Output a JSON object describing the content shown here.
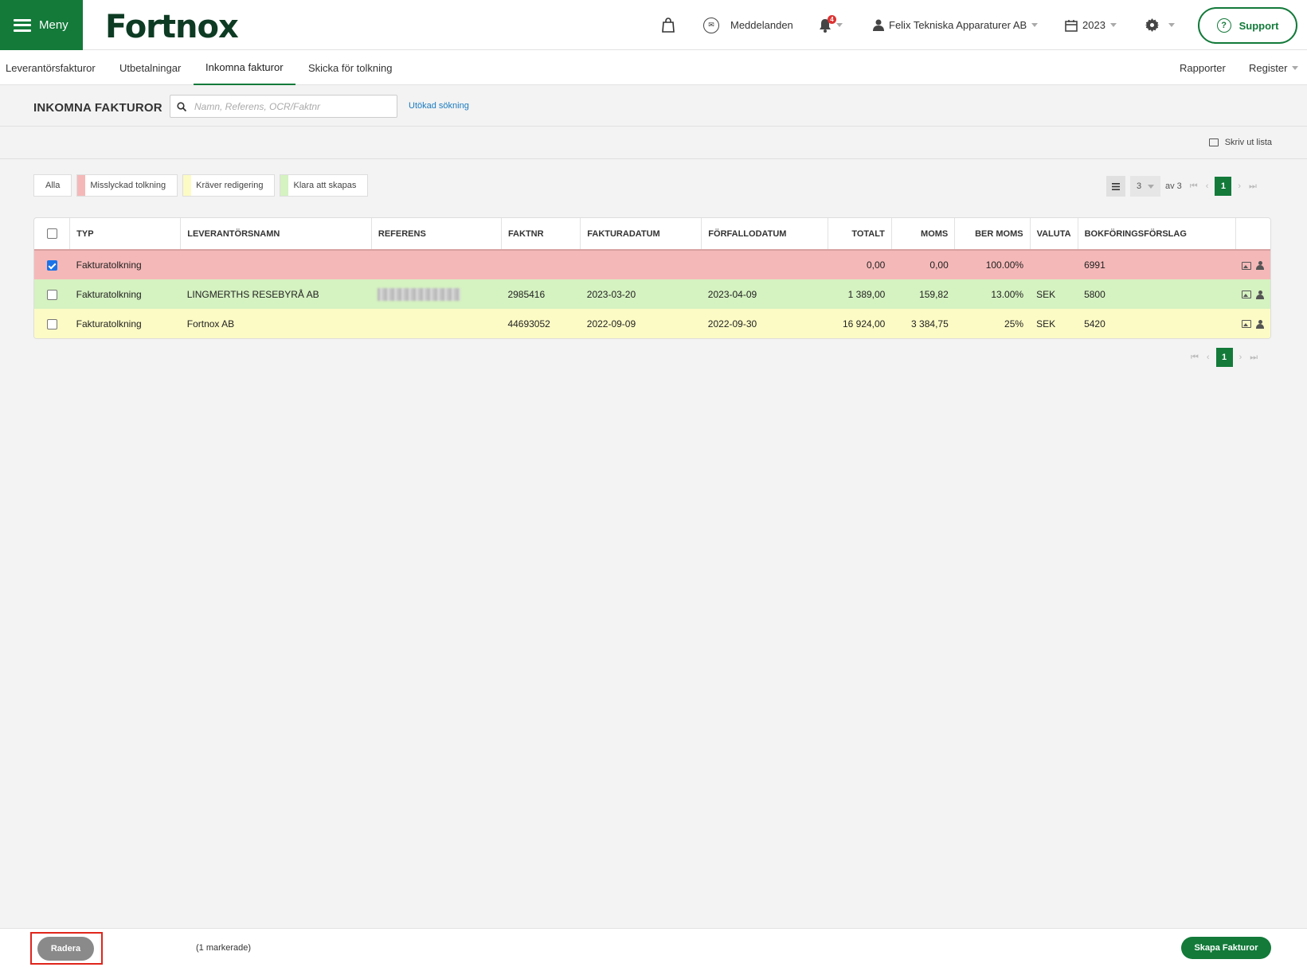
{
  "header": {
    "menu_label": "Meny",
    "logo": "Fortnox",
    "messages_label": "Meddelanden",
    "notification_count": "4",
    "company": "Felix Tekniska Apparaturer AB",
    "year": "2023",
    "support_label": "Support",
    "icons": [
      "hamburger-icon",
      "shopping-bag-icon",
      "envelope-icon",
      "bell-icon",
      "user-icon",
      "calendar-icon",
      "gear-icon",
      "question-icon"
    ]
  },
  "subnav": {
    "tabs": [
      {
        "label": "Leverantörsfakturor",
        "active": false
      },
      {
        "label": "Utbetalningar",
        "active": false
      },
      {
        "label": "Inkomna fakturor",
        "active": true
      },
      {
        "label": "Skicka för tolkning",
        "active": false
      }
    ],
    "right": [
      {
        "label": "Rapporter"
      },
      {
        "label": "Register"
      }
    ]
  },
  "search": {
    "title": "INKOMNA FAKTUROR",
    "placeholder": "Namn, Referens, OCR/Faktnr",
    "value": "",
    "advanced_label": "Utökad sökning"
  },
  "print_label": "Skriv ut lista",
  "filters": [
    {
      "label": "Alla",
      "color": ""
    },
    {
      "label": "Misslyckad tolkning",
      "color": "#f5b8b8"
    },
    {
      "label": "Kräver redigering",
      "color": "#fcfbc5"
    },
    {
      "label": "Klara att skapas",
      "color": "#d5f2c1"
    }
  ],
  "pagination": {
    "page_size": "3",
    "of_label": "av 3",
    "current_page": "1"
  },
  "table": {
    "columns": [
      "TYP",
      "LEVERANTÖRSNAMN",
      "REFERENS",
      "FAKTNR",
      "FAKTURADATUM",
      "FÖRFALLODATUM",
      "TOTALT",
      "MOMS",
      "BER MOMS",
      "VALUTA",
      "BOKFÖRINGSFÖRSLAG"
    ],
    "rows": [
      {
        "status": "red",
        "checked": true,
        "typ": "Fakturatolkning",
        "leverantor": "",
        "referens": "",
        "referens_redacted": false,
        "faktnr": "",
        "fakturadatum": "",
        "forfallodatum": "",
        "totalt": "0,00",
        "moms": "0,00",
        "ber_moms": "100.00%",
        "valuta": "",
        "bokforing": "6991"
      },
      {
        "status": "green",
        "checked": false,
        "typ": "Fakturatolkning",
        "leverantor": "LINGMERTHS RESEBYRÅ AB",
        "referens": "",
        "referens_redacted": true,
        "faktnr": "2985416",
        "fakturadatum": "2023-03-20",
        "forfallodatum": "2023-04-09",
        "totalt": "1 389,00",
        "moms": "159,82",
        "ber_moms": "13.00%",
        "valuta": "SEK",
        "bokforing": "5800"
      },
      {
        "status": "yellow",
        "checked": false,
        "typ": "Fakturatolkning",
        "leverantor": "Fortnox AB",
        "referens": "",
        "referens_redacted": false,
        "faktnr": "44693052",
        "fakturadatum": "2022-09-09",
        "forfallodatum": "2022-09-30",
        "totalt": "16 924,00",
        "moms": "3 384,75",
        "ber_moms": "25%",
        "valuta": "SEK",
        "bokforing": "5420"
      }
    ]
  },
  "footer": {
    "delete_label": "Radera",
    "marked_label": "(1 markerade)",
    "create_label": "Skapa Fakturor"
  },
  "colors": {
    "brand": "#137a3a",
    "failed": "#f5b8b8",
    "needs_edit": "#fcfbc5",
    "ready": "#d5f2c1",
    "highlight": "#e0251b"
  }
}
